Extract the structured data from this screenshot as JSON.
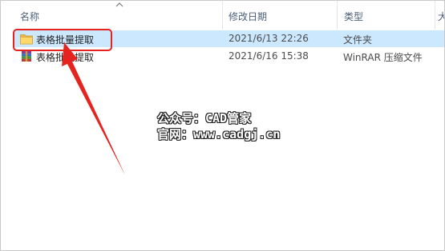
{
  "columns": {
    "name": "名称",
    "modified": "修改日期",
    "type": "类型",
    "size": "大"
  },
  "files": [
    {
      "name": "表格批量提取",
      "modified": "2021/6/13 22:26",
      "type": "文件夹",
      "icon": "folder-icon",
      "selected": true
    },
    {
      "name": "表格批量提取",
      "modified": "2021/6/16 15:38",
      "type": "WinRAR 压缩文件",
      "icon": "winrar-archive-icon",
      "selected": false
    }
  ],
  "watermark": {
    "line1": "公众号：CAD管家",
    "line2": "官网：www.cadgj.cn"
  },
  "colors": {
    "selection": "#cce8ff",
    "annotation_red": "#e52420",
    "header_text": "#4c607a"
  }
}
